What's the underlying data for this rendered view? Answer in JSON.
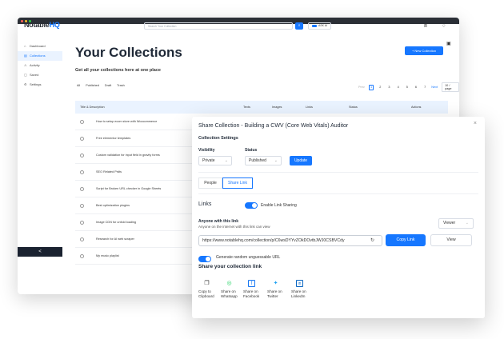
{
  "app": {
    "logo_main": "Notable",
    "logo_accent": "HQ",
    "search_placeholder": "Search Your Collection",
    "ask_label": "ASK AI",
    "colors": {
      "brand": "#1677ff",
      "dark": "#1a2230",
      "header_bg": "#eaf3ff"
    },
    "icons": {
      "user": "user-icon",
      "notification": "bell-icon",
      "cart": "cart-icon"
    }
  },
  "sidebar": {
    "items": [
      {
        "label": "Dashboard",
        "icon": "⌂"
      },
      {
        "label": "Collections",
        "icon": "▤"
      },
      {
        "label": "Activity",
        "icon": "⚠"
      },
      {
        "label": "Saved",
        "icon": "▢"
      },
      {
        "label": "Settings",
        "icon": "⚙"
      }
    ],
    "collapse_label": "<"
  },
  "main": {
    "title": "Your Collections",
    "subtitle": "Get all your collections here at one place",
    "new_button": "+ New Collection",
    "filters": [
      "All",
      "Published",
      "Draft",
      "Trash"
    ],
    "pager": {
      "prev": "Prev",
      "pages": [
        "1",
        "2",
        "3",
        "4",
        "5",
        "6",
        "7"
      ],
      "next": "Next",
      "per_page": "10 / page"
    },
    "columns": {
      "title": "Title & Description",
      "texts": "Texts",
      "images": "Images",
      "links": "Links",
      "status": "Status",
      "actions": "Actions"
    },
    "rows": [
      "How to setup ecom store with Woocommerce",
      "Free elementor templates",
      "Custom validation for input field in gravity forms",
      "SEO Related Prdts",
      "Script for Broken URL checker in Google Sheets",
      "Best optimization plugins",
      "Image CDN for unfold loading",
      "Research for AI web scraper",
      "My music playlist"
    ]
  },
  "modal": {
    "title": "Share Collection - Building a CWV (Core Web Vitals) Auditor",
    "close": "×",
    "settings_heading": "Collection Settings",
    "visibility_label": "Visibility",
    "visibility_value": "Private",
    "status_label": "Status",
    "status_value": "Published",
    "update_button": "Update",
    "tabs": [
      "People",
      "Share Link"
    ],
    "links_heading": "Links",
    "enable_sharing_label": "Enable Link Sharing",
    "anyone_heading": "Anyone with this link",
    "anyone_sub": "Anyone on the internet with this link can view",
    "permission_value": "Viewer",
    "share_url": "https://www.notablehq.com/collection/p/C6wsDYYvZOkDOvtbJWJ0CSBVCdy",
    "copy_button": "Copy Link",
    "view_button": "View",
    "random_label": "Generate random unguessable URL",
    "share_heading": "Share your collection link",
    "share_options": [
      {
        "icon": "copy-icon",
        "glyph": "❐",
        "color": "#333333",
        "line1": "Copy to",
        "line2": "Clipboard"
      },
      {
        "icon": "whatsapp-icon",
        "glyph": "◎",
        "color": "#25d366",
        "line1": "Share on",
        "line2": "Whatsapp"
      },
      {
        "icon": "facebook-icon",
        "glyph": "f",
        "color": "#1877f2",
        "line1": "Share on",
        "line2": "Facebook"
      },
      {
        "icon": "twitter-icon",
        "glyph": "✦",
        "color": "#1da1f2",
        "line1": "Share on",
        "line2": "Twitter"
      },
      {
        "icon": "linkedin-icon",
        "glyph": "in",
        "color": "#0a66c2",
        "line1": "Share on",
        "line2": "LinkedIn"
      }
    ]
  }
}
